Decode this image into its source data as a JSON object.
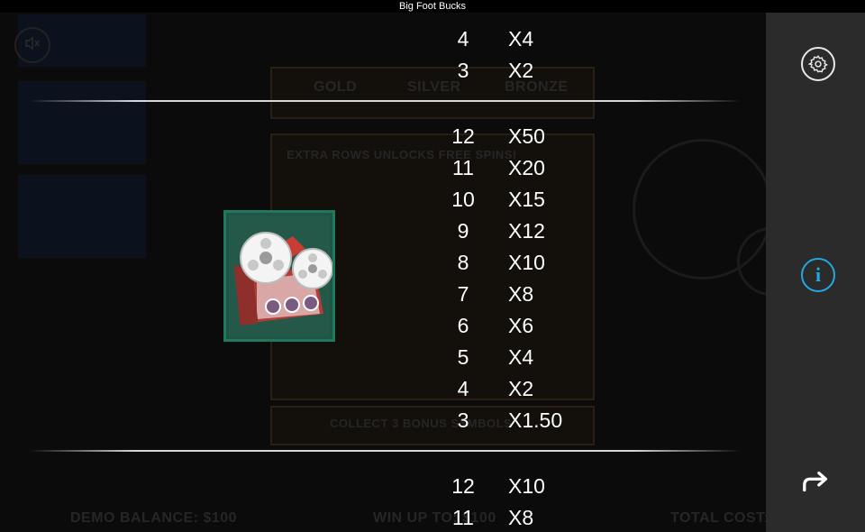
{
  "window": {
    "title": "Big Foot Bucks"
  },
  "background": {
    "tier_labels": [
      "GOLD",
      "SILVER",
      "BRONZE"
    ],
    "banner": "EXTRA ROWS UNLOCKS FREE SPINS!",
    "collect_text": "COLLECT 3 BONUS SYMBOLS",
    "demo_balance": "DEMO BALANCE: $100",
    "win_up_to": "WIN UP TO: $100",
    "total_cost": "TOTAL COST: $"
  },
  "paytable": {
    "symbol_icon": "film-projector-icon",
    "top_rows": [
      {
        "count": "4",
        "multiplier": "X4"
      },
      {
        "count": "3",
        "multiplier": "X2"
      }
    ],
    "projector_rows": [
      {
        "count": "12",
        "multiplier": "X50"
      },
      {
        "count": "11",
        "multiplier": "X20"
      },
      {
        "count": "10",
        "multiplier": "X15"
      },
      {
        "count": "9",
        "multiplier": "X12"
      },
      {
        "count": "8",
        "multiplier": "X10"
      },
      {
        "count": "7",
        "multiplier": "X8"
      },
      {
        "count": "6",
        "multiplier": "X6"
      },
      {
        "count": "5",
        "multiplier": "X4"
      },
      {
        "count": "4",
        "multiplier": "X2"
      },
      {
        "count": "3",
        "multiplier": "X1.50"
      }
    ],
    "bottom_rows": [
      {
        "count": "12",
        "multiplier": "X10"
      },
      {
        "count": "11",
        "multiplier": "X8"
      }
    ]
  },
  "sidebar": {
    "settings_icon": "gear-icon",
    "info_label": "i",
    "back_icon": "return-arrow-icon"
  },
  "colors": {
    "sidebar": "#2b2b2b",
    "info_accent": "#22a9e0",
    "symbol_frame": "#1d7a5d"
  }
}
